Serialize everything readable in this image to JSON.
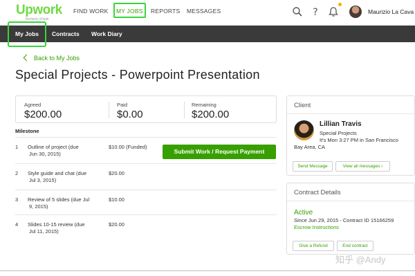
{
  "brand": {
    "logo": "Upwork",
    "sub": "formerly oDesk",
    "accent": "#37a000",
    "highlight": "#37d43a"
  },
  "topnav": {
    "items": [
      "FIND WORK",
      "MY JOBS",
      "REPORTS",
      "MESSAGES"
    ],
    "user_name": "Maurizio La Cava",
    "icons": [
      "search-icon",
      "help-icon",
      "bell-icon"
    ]
  },
  "subnav": {
    "items": [
      "My Jobs",
      "Contracts",
      "Work Diary"
    ]
  },
  "back_link": "Back to My Jobs",
  "page_title": "Special Projects - Powerpoint Presentation",
  "budget": [
    {
      "label": "Agreed",
      "value": "$200.00"
    },
    {
      "label": "Paid",
      "value": "$0.00"
    },
    {
      "label": "Remaining",
      "value": "$200.00"
    }
  ],
  "milestone_header": "Milestone",
  "milestones": [
    {
      "num": "1",
      "desc_line1": "Outline of project (due",
      "desc_line2": "Jun 30, 2015)",
      "amount": "$10.00 (Funded)"
    },
    {
      "num": "2",
      "desc_line1": "Style guide and chat (due",
      "desc_line2": "Jul 3, 2015)",
      "amount": "$20.00"
    },
    {
      "num": "3",
      "desc_line1": "Review of 5 slides (due Jul",
      "desc_line2": "9, 2015)",
      "amount": "$10.00"
    },
    {
      "num": "4",
      "desc_line1": "Slides 10-15 review (due",
      "desc_line2": "Jul 11, 2015)",
      "amount": "$20.00"
    }
  ],
  "submit_button": "Submit Work / Request Payment",
  "client_panel": {
    "title": "Client",
    "name": "Lillian Travis",
    "company": "Special Projects",
    "local_time": "It's Mon 3:27 PM in San Francisco",
    "location": "Bay Area, CA",
    "send_message": "Send Message",
    "view_messages": "View all messages ›"
  },
  "contract_panel": {
    "title": "Contract Details",
    "status": "Active",
    "since": "Since Jun 29, 2015 - Contract ID 15166259",
    "escrow": "Escrow Instructions",
    "refund": "Give a Refund",
    "end": "End contract"
  },
  "watermark": "知乎 @Andy"
}
